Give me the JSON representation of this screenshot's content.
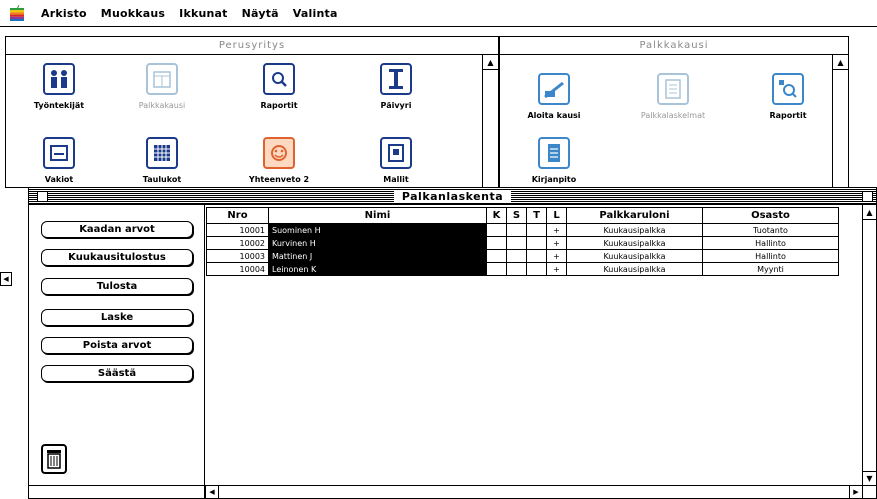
{
  "menubar": {
    "items": [
      "Arkisto",
      "Muokkaus",
      "Ikkunat",
      "Näytä",
      "Valinta"
    ]
  },
  "window_perus": {
    "title": "Perusyritys",
    "icons": [
      {
        "label": "Työntekijät",
        "icon": "people-icon"
      },
      {
        "label": "Palkkakausi",
        "icon": "calendar-icon"
      },
      {
        "label": "Raportit",
        "icon": "report-icon"
      },
      {
        "label": "Päivyri",
        "icon": "planner-icon"
      },
      {
        "label": "Vakiot",
        "icon": "constants-icon"
      },
      {
        "label": "Taulukot",
        "icon": "table-icon"
      },
      {
        "label": "Yhteenveto 2",
        "icon": "summary-icon"
      },
      {
        "label": "Mallit",
        "icon": "template-icon"
      }
    ]
  },
  "window_palkka": {
    "title": "Palkkakausi",
    "icons": [
      {
        "label": "Aloita kausi",
        "icon": "start-period-icon"
      },
      {
        "label": "Palkkalaskelmat",
        "icon": "calculations-icon"
      },
      {
        "label": "Raportit",
        "icon": "report-icon"
      },
      {
        "label": "Kirjanpito",
        "icon": "ledger-icon"
      }
    ]
  },
  "main_window": {
    "title": "Palkanlaskenta",
    "buttons": [
      "Kaadan arvot",
      "Kuukausitulostus",
      "Tulosta",
      "Laske",
      "Poista arvot",
      "Säästä"
    ],
    "table": {
      "headers": [
        "Nro",
        "Nimi",
        "K",
        "S",
        "T",
        "L",
        "Palkkaruloni",
        "Osasto"
      ],
      "rows": [
        {
          "nro": "10001",
          "nimi": "Suominen H",
          "k": "",
          "s": "",
          "t": "",
          "l": "+",
          "palkka": "Kuukausipalkka",
          "osasto": "Tuotanto"
        },
        {
          "nro": "10002",
          "nimi": "Kurvinen H",
          "k": "",
          "s": "",
          "t": "",
          "l": "+",
          "palkka": "Kuukausipalkka",
          "osasto": "Hallinto"
        },
        {
          "nro": "10003",
          "nimi": "Mattinen J",
          "k": "",
          "s": "",
          "t": "",
          "l": "+",
          "palkka": "Kuukausipalkka",
          "osasto": "Hallinto"
        },
        {
          "nro": "10004",
          "nimi": "Leinonen K",
          "k": "",
          "s": "",
          "t": "",
          "l": "+",
          "palkka": "Kuukausipalkka",
          "osasto": "Myynti"
        }
      ]
    }
  }
}
